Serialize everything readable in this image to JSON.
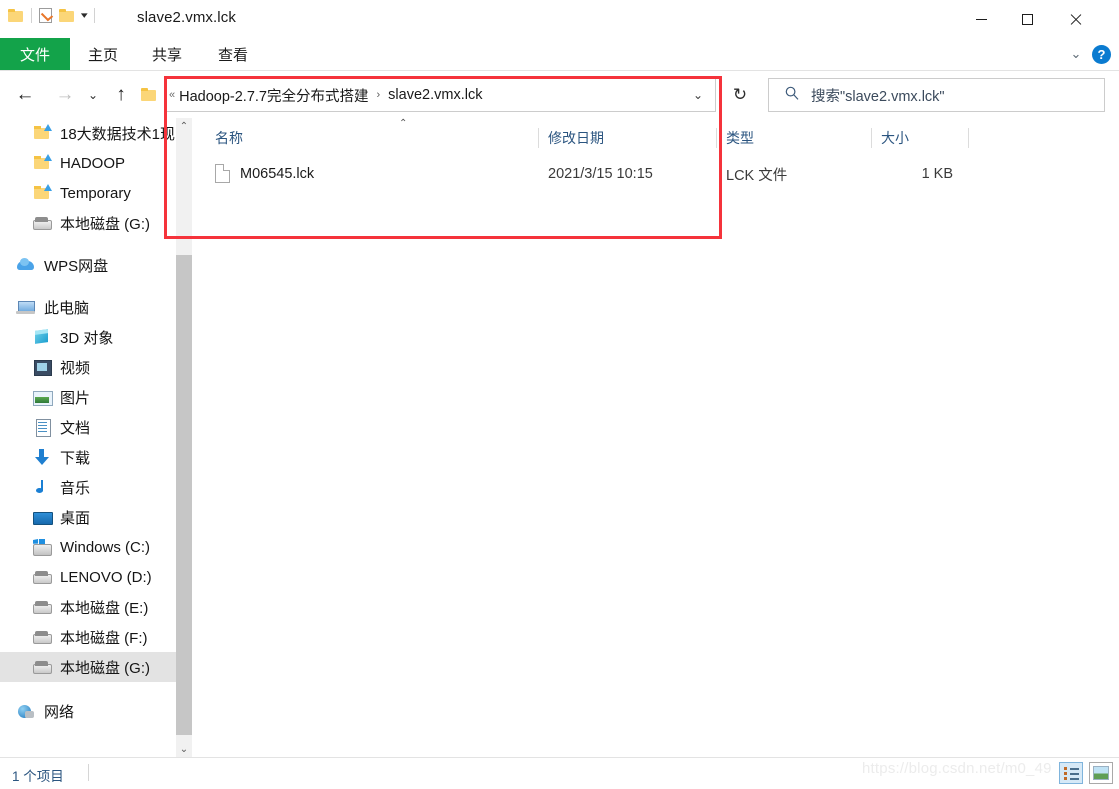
{
  "window": {
    "title": "slave2.vmx.lck",
    "quick_access": {
      "folder_icon": "folder-icon",
      "properties_icon": "properties-checkbox-icon",
      "new_folder_icon": "new-folder-icon",
      "customize_caret": "chevron-down-icon"
    },
    "controls": {
      "minimize": "minimize-icon",
      "maximize": "maximize-icon",
      "close": "close-icon"
    }
  },
  "ribbon": {
    "tabs": [
      {
        "label": "文件",
        "active": true
      },
      {
        "label": "主页",
        "active": false
      },
      {
        "label": "共享",
        "active": false
      },
      {
        "label": "查看",
        "active": false
      }
    ],
    "collapse_icon": "chevron-down-icon",
    "help_label": "?",
    "file_tab_color": "#13a34a"
  },
  "navigation": {
    "back_icon": "arrow-left-icon",
    "forward_icon": "arrow-right-icon",
    "recent_icon": "chevron-down-icon",
    "up_icon": "arrow-up-icon",
    "refresh_icon": "refresh-icon"
  },
  "address": {
    "overflow_chevron": "«",
    "crumbs": [
      "Hadoop-2.7.7完全分布式搭建",
      "slave2.vmx.lck"
    ],
    "separator": "›",
    "dropdown_icon": "chevron-down-icon"
  },
  "search": {
    "icon": "search-icon",
    "value": "搜索\"slave2.vmx.lck\""
  },
  "sidebar": {
    "items": [
      {
        "label": "18大数据技术1现",
        "icon": "pinned-folder-icon",
        "indent": 32,
        "selected": false
      },
      {
        "label": "HADOOP",
        "icon": "pinned-folder-icon",
        "indent": 32,
        "selected": false
      },
      {
        "label": "Temporary",
        "icon": "pinned-folder-icon",
        "indent": 32,
        "selected": false
      },
      {
        "label": "本地磁盘 (G:)",
        "icon": "drive-icon",
        "indent": 32,
        "selected": false
      },
      {
        "label": "WPS网盘",
        "icon": "cloud-icon",
        "indent": 16,
        "selected": false
      },
      {
        "label": "此电脑",
        "icon": "this-pc-icon",
        "indent": 16,
        "selected": false
      },
      {
        "label": "3D 对象",
        "icon": "3d-objects-icon",
        "indent": 32,
        "selected": false
      },
      {
        "label": "视频",
        "icon": "videos-icon",
        "indent": 32,
        "selected": false
      },
      {
        "label": "图片",
        "icon": "pictures-icon",
        "indent": 32,
        "selected": false
      },
      {
        "label": "文档",
        "icon": "documents-icon",
        "indent": 32,
        "selected": false
      },
      {
        "label": "下载",
        "icon": "downloads-icon",
        "indent": 32,
        "selected": false
      },
      {
        "label": "音乐",
        "icon": "music-icon",
        "indent": 32,
        "selected": false
      },
      {
        "label": "桌面",
        "icon": "desktop-icon",
        "indent": 32,
        "selected": false
      },
      {
        "label": "Windows (C:)",
        "icon": "windows-drive-icon",
        "indent": 32,
        "selected": false
      },
      {
        "label": "LENOVO (D:)",
        "icon": "drive-icon",
        "indent": 32,
        "selected": false
      },
      {
        "label": "本地磁盘 (E:)",
        "icon": "drive-icon",
        "indent": 32,
        "selected": false
      },
      {
        "label": "本地磁盘 (F:)",
        "icon": "drive-icon",
        "indent": 32,
        "selected": false
      },
      {
        "label": "本地磁盘 (G:)",
        "icon": "drive-icon",
        "indent": 32,
        "selected": true
      },
      {
        "label": "网络",
        "icon": "network-icon",
        "indent": 16,
        "selected": false
      }
    ],
    "scroll_up_icon": "chevron-up-icon",
    "scroll_down_icon": "chevron-down-icon"
  },
  "filelist": {
    "columns": [
      "名称",
      "修改日期",
      "类型",
      "大小"
    ],
    "sort_indicator": "ascending-caret",
    "rows": [
      {
        "name": "M06545.lck",
        "date": "2021/3/15 10:15",
        "type": "LCK 文件",
        "size": "1 KB",
        "icon": "generic-file-icon"
      }
    ]
  },
  "annotation": {
    "color": "#f5333b"
  },
  "status": {
    "item_count": "1 个项目",
    "watermark": "https://blog.csdn.net/m0_49",
    "view_details_icon": "details-view-icon",
    "view_icons_icon": "large-icons-view-icon"
  }
}
